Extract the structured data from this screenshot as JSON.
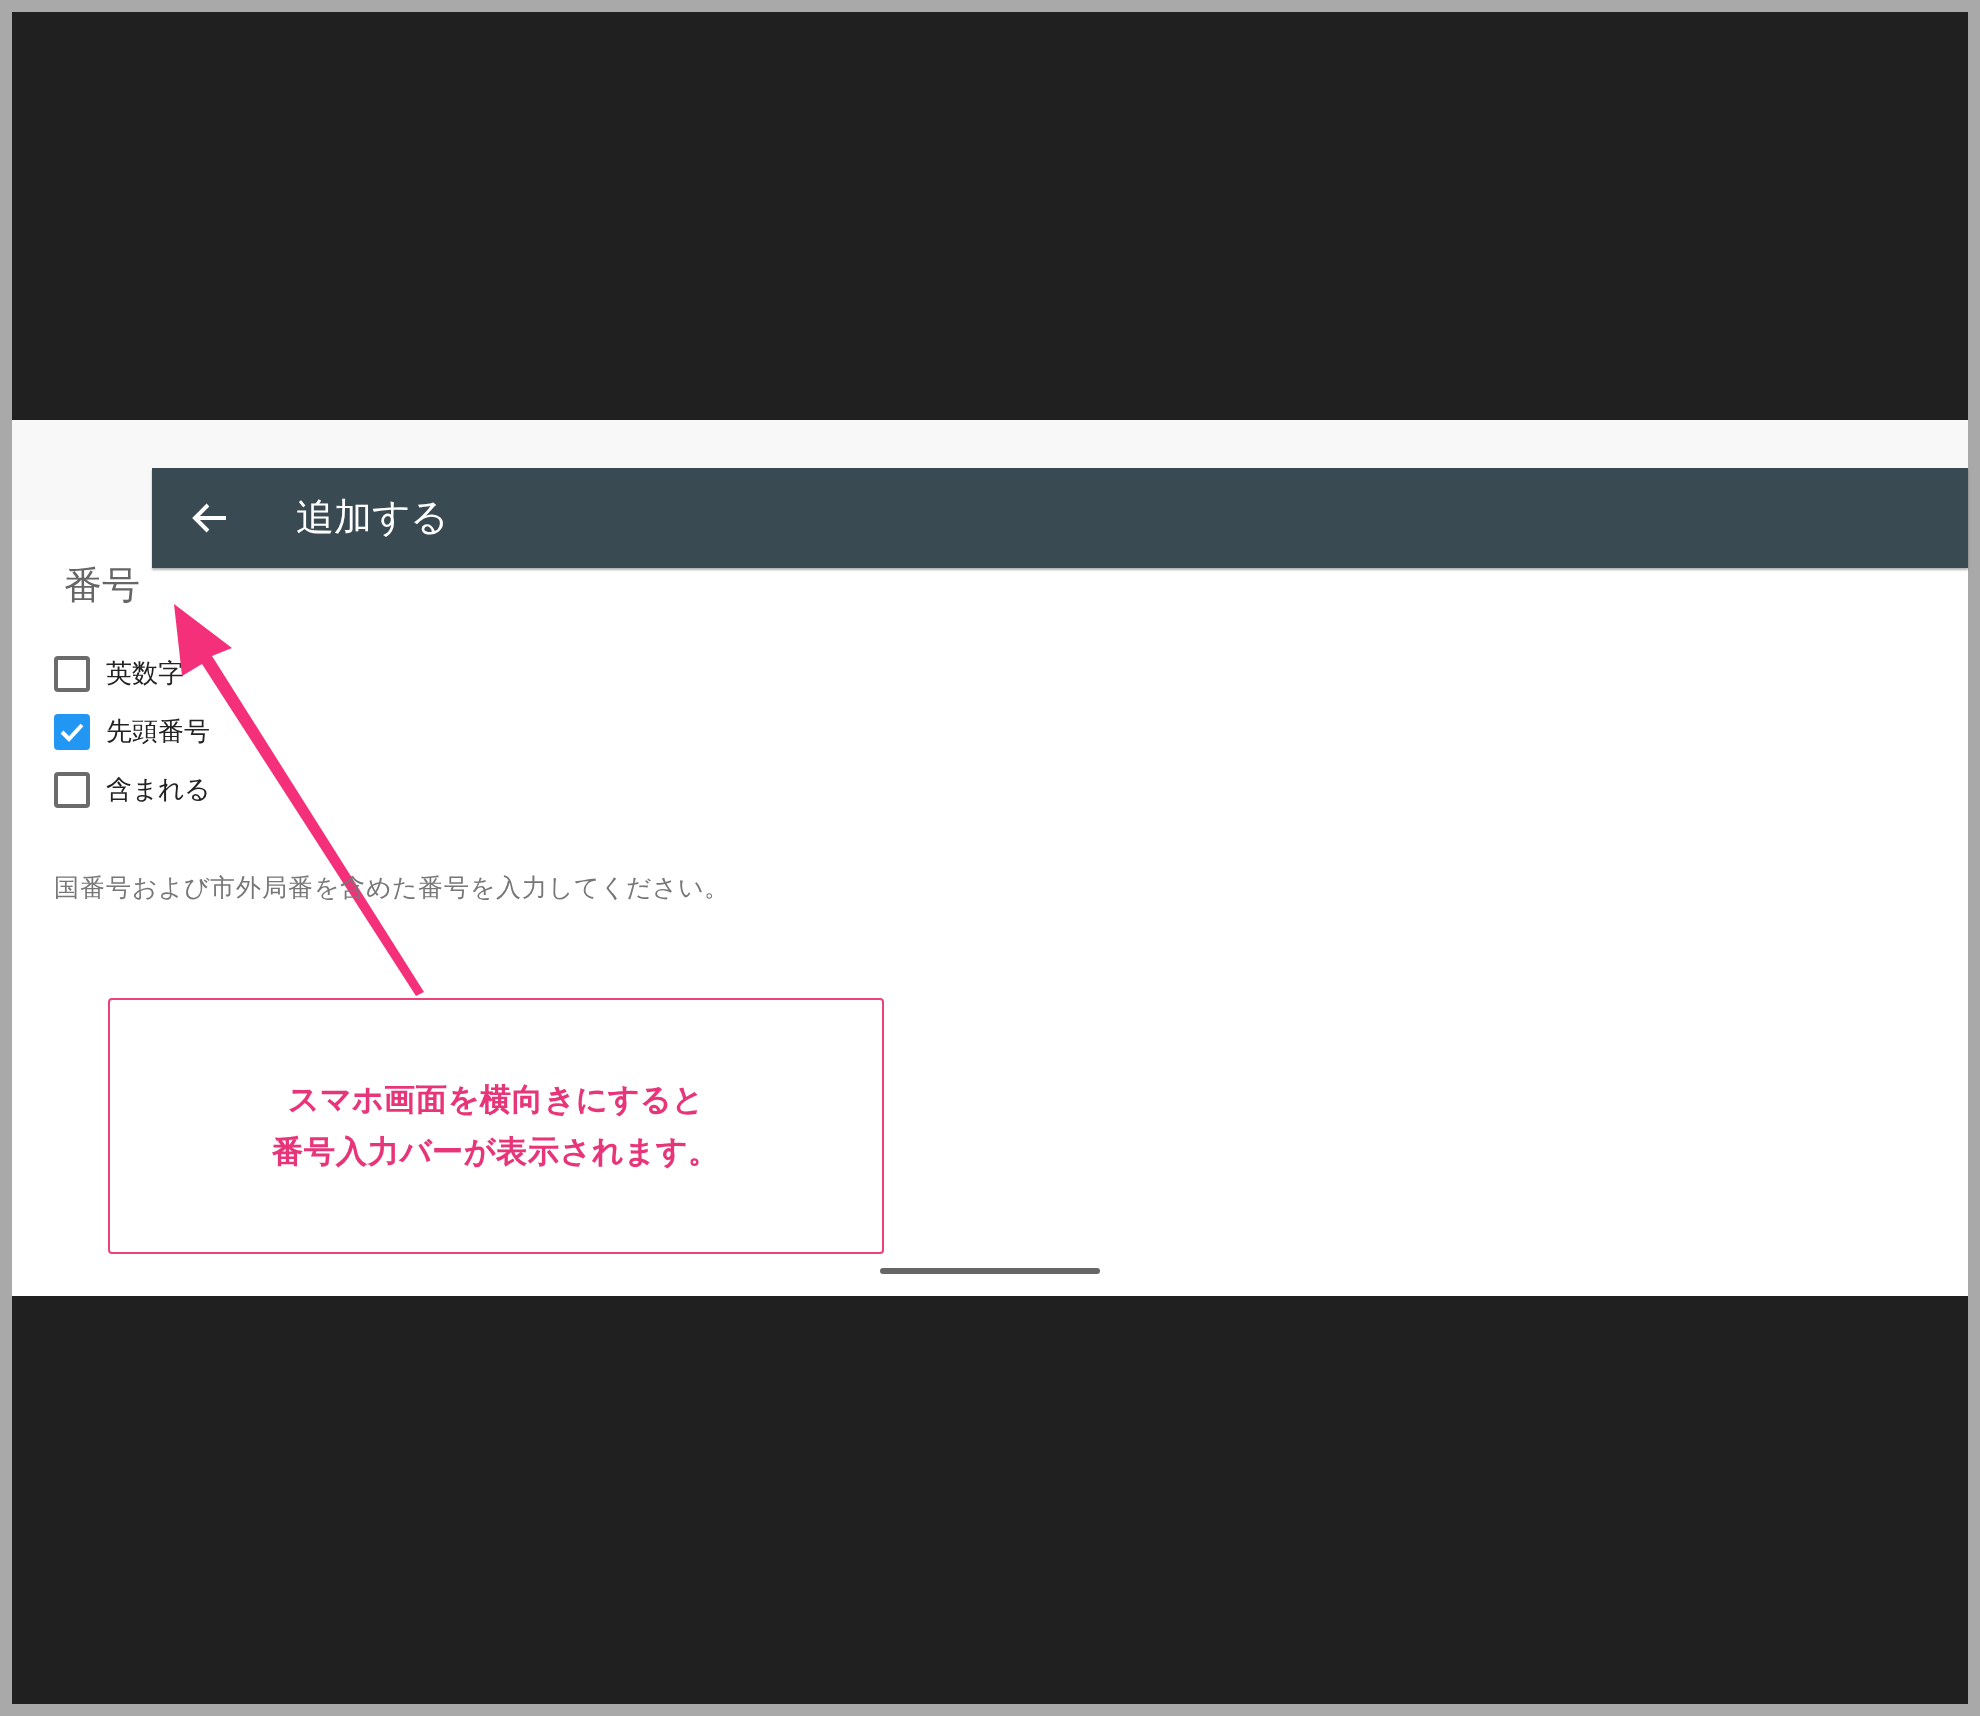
{
  "toolbar": {
    "title": "追加する"
  },
  "field": {
    "label": "番号"
  },
  "options": [
    {
      "label": "英数字",
      "checked": false
    },
    {
      "label": "先頭番号",
      "checked": true
    },
    {
      "label": "含まれる",
      "checked": false
    }
  ],
  "hint": "国番号および市外局番を含めた番号を入力してください。",
  "callout": {
    "lines": [
      "スマホ画面を横向きにすると",
      "番号入力バーが表示されます。"
    ]
  }
}
